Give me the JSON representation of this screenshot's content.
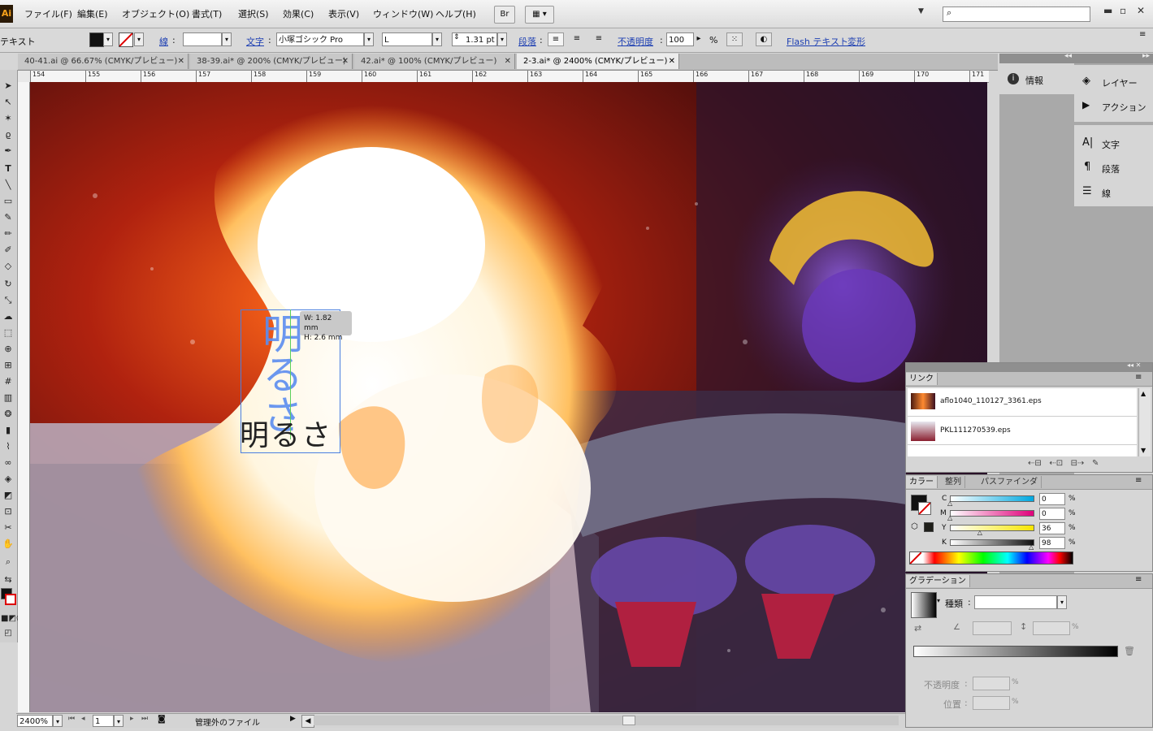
{
  "app": {
    "logo": "Ai"
  },
  "menu": {
    "items": [
      "ファイル(F)",
      "編集(E)",
      "オブジェクト(O)",
      "書式(T)",
      "選択(S)",
      "効果(C)",
      "表示(V)",
      "ウィンドウ(W)",
      "ヘルプ(H)"
    ],
    "bridge_button": "Br"
  },
  "control": {
    "mode_label": "テキスト",
    "stroke_label": "線",
    "char_label": "文字",
    "font_family": "小塚ゴシック Pro",
    "font_style": "L",
    "font_size": "1.31 pt",
    "para_label": "段落",
    "opacity_label": "不透明度",
    "opacity_value": "100",
    "opacity_unit": "%",
    "flash_label": "Flash テキスト",
    "transform_label": "変形"
  },
  "tabs": [
    {
      "label": "40-41.ai @ 66.67% (CMYK/プレビュー)",
      "active": false
    },
    {
      "label": "38-39.ai* @ 200% (CMYK/プレビュー)",
      "active": false
    },
    {
      "label": "42.ai* @ 100% (CMYK/プレビュー)",
      "active": false
    },
    {
      "label": "2-3.ai* @ 2400% (CMYK/プレビュー)",
      "active": true
    }
  ],
  "ruler": {
    "ticks": [
      "154",
      "155",
      "156",
      "157",
      "158",
      "159",
      "160",
      "161",
      "162",
      "163",
      "164",
      "165",
      "166",
      "167",
      "168",
      "169",
      "170",
      "171"
    ]
  },
  "canvas": {
    "vertical_text": "明るさ",
    "horizontal_text": "明るさ",
    "size_tooltip_w": "W: 1.82 mm",
    "size_tooltip_h": "H: 2.6 mm"
  },
  "status": {
    "zoom": "2400%",
    "page": "1",
    "status_text": "管理外のファイル"
  },
  "dock": {
    "info_label": "情報",
    "layers_label": "レイヤー",
    "actions_label": "アクション",
    "character_label": "文字",
    "paragraph_label": "段落",
    "stroke_label": "線"
  },
  "links_panel": {
    "title": "リンク",
    "items": [
      "aflo1040_110127_3361.eps",
      "PKL111270539.eps"
    ]
  },
  "color_panel": {
    "tabs": [
      "カラー",
      "整列",
      "パスファインダ"
    ],
    "channels": [
      {
        "name": "C",
        "value": "0",
        "color": "#00a8e0"
      },
      {
        "name": "M",
        "value": "0",
        "color": "#e0007a"
      },
      {
        "name": "Y",
        "value": "36",
        "color": "#f7e600"
      },
      {
        "name": "K",
        "value": "98",
        "color": "#111111"
      }
    ],
    "unit": "%",
    "fill_color": "#1f1f1a"
  },
  "gradient_panel": {
    "title": "グラデーション",
    "type_label": "種類",
    "opacity_label": "不透明度",
    "position_label": "位置",
    "unit": "%"
  }
}
